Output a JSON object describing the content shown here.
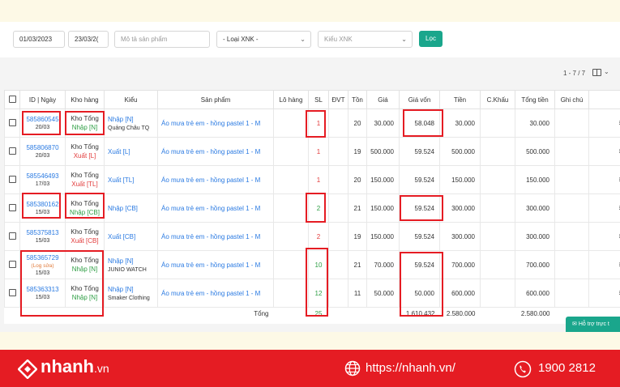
{
  "filters": {
    "date_from": "01/03/2023",
    "date_to": "23/03/2(",
    "product_placeholder": "Mô tả sản phẩm",
    "type_select": "- Loại XNK -",
    "kind_placeholder": "Kiểu XNK",
    "filter_button": "Lọc"
  },
  "pager": {
    "range": "1 - 7 / 7"
  },
  "table": {
    "headers": {
      "id": "ID | Ngày",
      "warehouse": "Kho hàng",
      "kind": "Kiểu",
      "product": "Sản phẩm",
      "lot": "Lô hàng",
      "qty": "SL",
      "unit": "ĐVT",
      "stock": "Tồn",
      "price": "Giá",
      "cost": "Giá vốn",
      "amount": "Tiền",
      "discount": "C.Khấu",
      "total": "Tổng tiền",
      "note": "Ghi chú"
    },
    "rows": [
      {
        "id": "585860545",
        "date": "20/03",
        "note_tag": "",
        "warehouse": "Kho Tổng",
        "direction": "Nhập [N]",
        "dir": "in",
        "kind": "Nhập [N]",
        "kind_sub": "Quảng Châu TQ",
        "product": "Áo mưa trẻ em - hồng pastel 1 - M",
        "qty": "1",
        "qty_color": "red",
        "stock": "20",
        "price": "30.000",
        "cost": "58.048",
        "amount": "30.000",
        "total": "30.000"
      },
      {
        "id": "585806870",
        "date": "20/03",
        "note_tag": "",
        "warehouse": "Kho Tổng",
        "direction": "Xuất [L]",
        "dir": "out",
        "kind": "Xuất [L]",
        "kind_sub": "",
        "product": "Áo mưa trẻ em - hồng pastel 1 - M",
        "qty": "1",
        "qty_color": "red",
        "stock": "19",
        "price": "500.000",
        "cost": "59.524",
        "amount": "500.000",
        "total": "500.000"
      },
      {
        "id": "585546493",
        "date": "17/03",
        "note_tag": "",
        "warehouse": "Kho Tổng",
        "direction": "Xuất [TL]",
        "dir": "out",
        "kind": "Xuất [TL]",
        "kind_sub": "",
        "product": "Áo mưa trẻ em - hồng pastel 1 - M",
        "qty": "1",
        "qty_color": "red",
        "stock": "20",
        "price": "150.000",
        "cost": "59.524",
        "amount": "150.000",
        "total": "150.000"
      },
      {
        "id": "585380162",
        "date": "15/03",
        "note_tag": "",
        "warehouse": "Kho Tổng",
        "direction": "Nhập [CB]",
        "dir": "in",
        "kind": "Nhập [CB]",
        "kind_sub": "",
        "product": "Áo mưa trẻ em - hồng pastel 1 - M",
        "qty": "2",
        "qty_color": "green",
        "stock": "21",
        "price": "150.000",
        "cost": "59.524",
        "amount": "300.000",
        "total": "300.000"
      },
      {
        "id": "585375813",
        "date": "15/03",
        "note_tag": "",
        "warehouse": "Kho Tổng",
        "direction": "Xuất [CB]",
        "dir": "out",
        "kind": "Xuất [CB]",
        "kind_sub": "",
        "product": "Áo mưa trẻ em - hồng pastel 1 - M",
        "qty": "2",
        "qty_color": "red",
        "stock": "19",
        "price": "150.000",
        "cost": "59.524",
        "amount": "300.000",
        "total": "300.000"
      },
      {
        "id": "585365729",
        "date": "15/03",
        "note_tag": "(Log sửa)",
        "warehouse": "Kho Tổng",
        "direction": "Nhập [N]",
        "dir": "in",
        "kind": "Nhập [N]",
        "kind_sub": "JUNIO WATCH",
        "product": "Áo mưa trẻ em - hồng pastel 1 - M",
        "qty": "10",
        "qty_color": "green",
        "stock": "21",
        "price": "70.000",
        "cost": "59.524",
        "amount": "700.000",
        "total": "700.000"
      },
      {
        "id": "585363313",
        "date": "15/03",
        "note_tag": "",
        "warehouse": "Kho Tổng",
        "direction": "Nhập [N]",
        "dir": "in",
        "kind": "Nhập [N]",
        "kind_sub": "Smaker Clothing",
        "product": "Áo mưa trẻ em - hồng pastel 1 - M",
        "qty": "12",
        "qty_color": "green",
        "stock": "11",
        "price": "50.000",
        "cost": "50.000",
        "amount": "600.000",
        "total": "600.000"
      }
    ],
    "totals": {
      "label": "Tổng",
      "qty": "25",
      "cost": "1.610.432",
      "amount": "2.580.000",
      "total": "2.580.000"
    }
  },
  "support": {
    "label": "Hỗ trợ trực t"
  },
  "footer": {
    "brand": "nhanh",
    "brand_tld": ".vn",
    "website": "https://nhanh.vn/",
    "hotline": "1900 2812"
  },
  "colors": {
    "accent_green": "#1aa68c",
    "brand_red": "#e51c23",
    "link_blue": "#2a7ae2",
    "highlight_red": "#e51c23"
  }
}
